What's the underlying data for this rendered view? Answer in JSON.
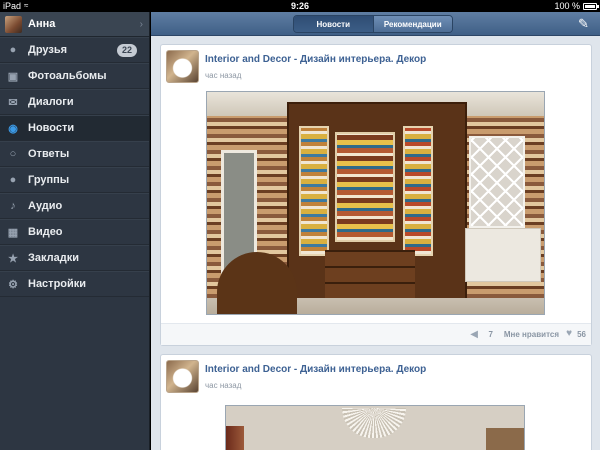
{
  "statusbar": {
    "carrier": "iPad",
    "time": "9:26",
    "battery": "100 %",
    "wifi_icon": "wifi-icon",
    "battery_icon": "battery-icon"
  },
  "profile": {
    "name": "Анна"
  },
  "sidebar": {
    "items": [
      {
        "label": "Друзья",
        "icon": "friends-icon",
        "badge": "22"
      },
      {
        "label": "Фотоальбомы",
        "icon": "camera-icon"
      },
      {
        "label": "Диалоги",
        "icon": "envelope-icon"
      },
      {
        "label": "Новости",
        "icon": "speech-bubble-icon",
        "active": true
      },
      {
        "label": "Ответы",
        "icon": "chat-bubbles-icon"
      },
      {
        "label": "Группы",
        "icon": "group-icon"
      },
      {
        "label": "Аудио",
        "icon": "music-note-icon"
      },
      {
        "label": "Видео",
        "icon": "film-icon"
      },
      {
        "label": "Закладки",
        "icon": "star-icon"
      },
      {
        "label": "Настройки",
        "icon": "gear-icon"
      }
    ]
  },
  "topbar": {
    "tabs": [
      {
        "label": "Новости",
        "selected": true
      },
      {
        "label": "Рекомендации",
        "selected": false
      }
    ],
    "compose_icon": "compose-icon"
  },
  "feed": {
    "posts": [
      {
        "author": "Interior and Decor - Дизайн интерьера. Декор",
        "time": "час назад",
        "reposts": "7",
        "like_label": "Мне нравится",
        "likes": "56"
      },
      {
        "author": "Interior and Decor - Дизайн интерьера. Декор",
        "time": "час назад"
      }
    ]
  },
  "colors": {
    "sidebar_bg": "#2d3642",
    "topbar": "#4a6a92",
    "link": "#3d6193",
    "active_icon": "#3b9ae6"
  }
}
